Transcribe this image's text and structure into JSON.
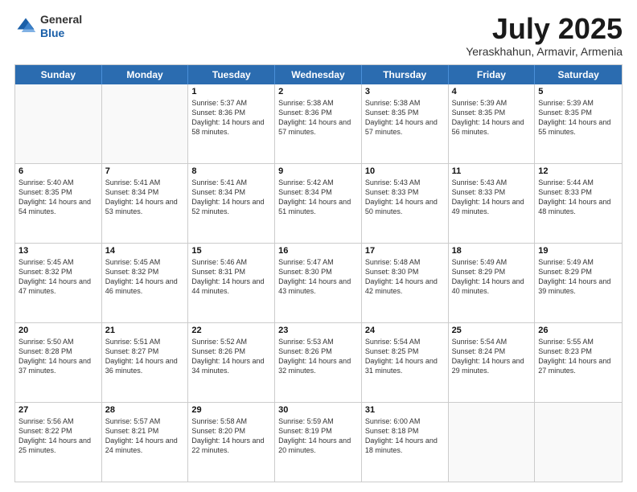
{
  "header": {
    "logo_line1": "General",
    "logo_line2": "Blue",
    "month_title": "July 2025",
    "location": "Yeraskhahun, Armavir, Armenia"
  },
  "days_of_week": [
    "Sunday",
    "Monday",
    "Tuesday",
    "Wednesday",
    "Thursday",
    "Friday",
    "Saturday"
  ],
  "weeks": [
    [
      {
        "day": "",
        "sunrise": "",
        "sunset": "",
        "daylight": ""
      },
      {
        "day": "",
        "sunrise": "",
        "sunset": "",
        "daylight": ""
      },
      {
        "day": "1",
        "sunrise": "Sunrise: 5:37 AM",
        "sunset": "Sunset: 8:36 PM",
        "daylight": "Daylight: 14 hours and 58 minutes."
      },
      {
        "day": "2",
        "sunrise": "Sunrise: 5:38 AM",
        "sunset": "Sunset: 8:36 PM",
        "daylight": "Daylight: 14 hours and 57 minutes."
      },
      {
        "day": "3",
        "sunrise": "Sunrise: 5:38 AM",
        "sunset": "Sunset: 8:35 PM",
        "daylight": "Daylight: 14 hours and 57 minutes."
      },
      {
        "day": "4",
        "sunrise": "Sunrise: 5:39 AM",
        "sunset": "Sunset: 8:35 PM",
        "daylight": "Daylight: 14 hours and 56 minutes."
      },
      {
        "day": "5",
        "sunrise": "Sunrise: 5:39 AM",
        "sunset": "Sunset: 8:35 PM",
        "daylight": "Daylight: 14 hours and 55 minutes."
      }
    ],
    [
      {
        "day": "6",
        "sunrise": "Sunrise: 5:40 AM",
        "sunset": "Sunset: 8:35 PM",
        "daylight": "Daylight: 14 hours and 54 minutes."
      },
      {
        "day": "7",
        "sunrise": "Sunrise: 5:41 AM",
        "sunset": "Sunset: 8:34 PM",
        "daylight": "Daylight: 14 hours and 53 minutes."
      },
      {
        "day": "8",
        "sunrise": "Sunrise: 5:41 AM",
        "sunset": "Sunset: 8:34 PM",
        "daylight": "Daylight: 14 hours and 52 minutes."
      },
      {
        "day": "9",
        "sunrise": "Sunrise: 5:42 AM",
        "sunset": "Sunset: 8:34 PM",
        "daylight": "Daylight: 14 hours and 51 minutes."
      },
      {
        "day": "10",
        "sunrise": "Sunrise: 5:43 AM",
        "sunset": "Sunset: 8:33 PM",
        "daylight": "Daylight: 14 hours and 50 minutes."
      },
      {
        "day": "11",
        "sunrise": "Sunrise: 5:43 AM",
        "sunset": "Sunset: 8:33 PM",
        "daylight": "Daylight: 14 hours and 49 minutes."
      },
      {
        "day": "12",
        "sunrise": "Sunrise: 5:44 AM",
        "sunset": "Sunset: 8:33 PM",
        "daylight": "Daylight: 14 hours and 48 minutes."
      }
    ],
    [
      {
        "day": "13",
        "sunrise": "Sunrise: 5:45 AM",
        "sunset": "Sunset: 8:32 PM",
        "daylight": "Daylight: 14 hours and 47 minutes."
      },
      {
        "day": "14",
        "sunrise": "Sunrise: 5:45 AM",
        "sunset": "Sunset: 8:32 PM",
        "daylight": "Daylight: 14 hours and 46 minutes."
      },
      {
        "day": "15",
        "sunrise": "Sunrise: 5:46 AM",
        "sunset": "Sunset: 8:31 PM",
        "daylight": "Daylight: 14 hours and 44 minutes."
      },
      {
        "day": "16",
        "sunrise": "Sunrise: 5:47 AM",
        "sunset": "Sunset: 8:30 PM",
        "daylight": "Daylight: 14 hours and 43 minutes."
      },
      {
        "day": "17",
        "sunrise": "Sunrise: 5:48 AM",
        "sunset": "Sunset: 8:30 PM",
        "daylight": "Daylight: 14 hours and 42 minutes."
      },
      {
        "day": "18",
        "sunrise": "Sunrise: 5:49 AM",
        "sunset": "Sunset: 8:29 PM",
        "daylight": "Daylight: 14 hours and 40 minutes."
      },
      {
        "day": "19",
        "sunrise": "Sunrise: 5:49 AM",
        "sunset": "Sunset: 8:29 PM",
        "daylight": "Daylight: 14 hours and 39 minutes."
      }
    ],
    [
      {
        "day": "20",
        "sunrise": "Sunrise: 5:50 AM",
        "sunset": "Sunset: 8:28 PM",
        "daylight": "Daylight: 14 hours and 37 minutes."
      },
      {
        "day": "21",
        "sunrise": "Sunrise: 5:51 AM",
        "sunset": "Sunset: 8:27 PM",
        "daylight": "Daylight: 14 hours and 36 minutes."
      },
      {
        "day": "22",
        "sunrise": "Sunrise: 5:52 AM",
        "sunset": "Sunset: 8:26 PM",
        "daylight": "Daylight: 14 hours and 34 minutes."
      },
      {
        "day": "23",
        "sunrise": "Sunrise: 5:53 AM",
        "sunset": "Sunset: 8:26 PM",
        "daylight": "Daylight: 14 hours and 32 minutes."
      },
      {
        "day": "24",
        "sunrise": "Sunrise: 5:54 AM",
        "sunset": "Sunset: 8:25 PM",
        "daylight": "Daylight: 14 hours and 31 minutes."
      },
      {
        "day": "25",
        "sunrise": "Sunrise: 5:54 AM",
        "sunset": "Sunset: 8:24 PM",
        "daylight": "Daylight: 14 hours and 29 minutes."
      },
      {
        "day": "26",
        "sunrise": "Sunrise: 5:55 AM",
        "sunset": "Sunset: 8:23 PM",
        "daylight": "Daylight: 14 hours and 27 minutes."
      }
    ],
    [
      {
        "day": "27",
        "sunrise": "Sunrise: 5:56 AM",
        "sunset": "Sunset: 8:22 PM",
        "daylight": "Daylight: 14 hours and 25 minutes."
      },
      {
        "day": "28",
        "sunrise": "Sunrise: 5:57 AM",
        "sunset": "Sunset: 8:21 PM",
        "daylight": "Daylight: 14 hours and 24 minutes."
      },
      {
        "day": "29",
        "sunrise": "Sunrise: 5:58 AM",
        "sunset": "Sunset: 8:20 PM",
        "daylight": "Daylight: 14 hours and 22 minutes."
      },
      {
        "day": "30",
        "sunrise": "Sunrise: 5:59 AM",
        "sunset": "Sunset: 8:19 PM",
        "daylight": "Daylight: 14 hours and 20 minutes."
      },
      {
        "day": "31",
        "sunrise": "Sunrise: 6:00 AM",
        "sunset": "Sunset: 8:18 PM",
        "daylight": "Daylight: 14 hours and 18 minutes."
      },
      {
        "day": "",
        "sunrise": "",
        "sunset": "",
        "daylight": ""
      },
      {
        "day": "",
        "sunrise": "",
        "sunset": "",
        "daylight": ""
      }
    ]
  ]
}
